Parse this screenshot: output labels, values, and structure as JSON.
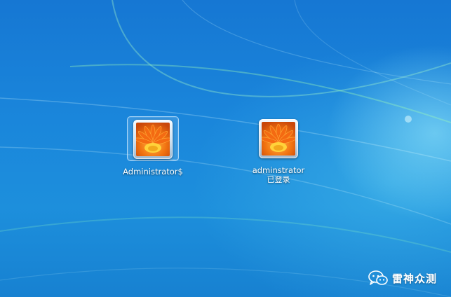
{
  "colors": {
    "desktop_background": "#1a86db",
    "label_text": "#ffffff",
    "picture_orange": "#f36f12",
    "picture_yellow": "#ffd23a"
  },
  "icons": {
    "user_picture": "orange-flower-icon",
    "watermark": "wechat-icon"
  },
  "users": [
    {
      "name": "Administrator$",
      "status": "",
      "selected": true
    },
    {
      "name": "adminstrator",
      "status": "已登录",
      "selected": false
    }
  ],
  "watermark": {
    "text": "雷神众测"
  }
}
